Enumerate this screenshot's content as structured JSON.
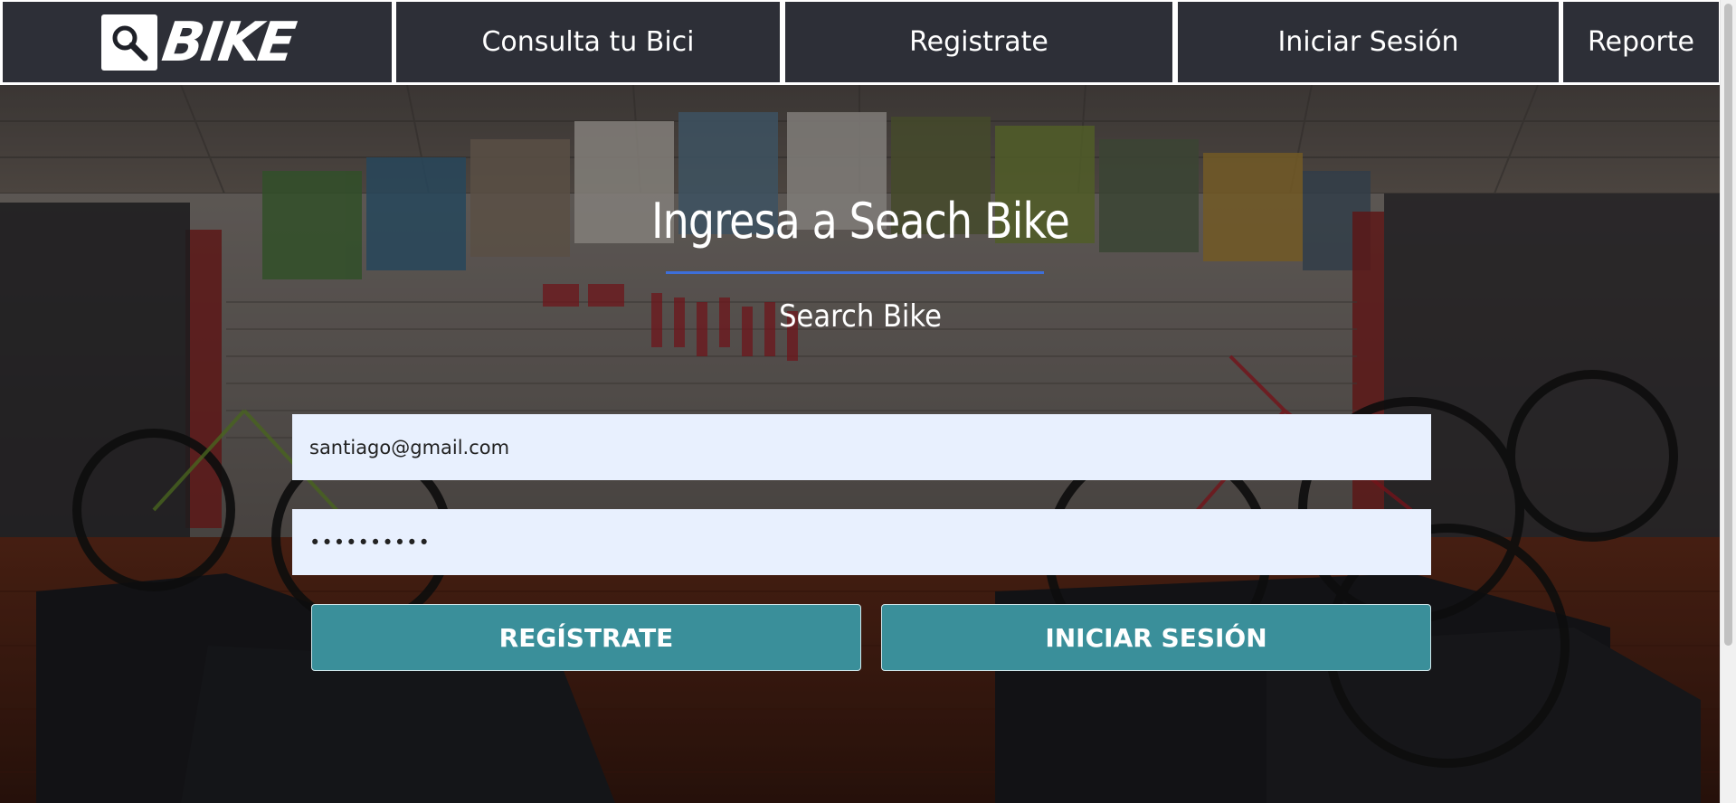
{
  "nav": {
    "logo_text": "BIKE",
    "items": [
      {
        "label": "Consulta tu Bici"
      },
      {
        "label": "Registrate"
      },
      {
        "label": "Iniciar Sesión"
      },
      {
        "label": "Reporte"
      }
    ]
  },
  "hero": {
    "title": "Ingresa a Seach Bike",
    "subtitle": "Search Bike"
  },
  "form": {
    "email_value": "santiago@gmail.com",
    "password_value": "••••••••••",
    "register_button": "REGÍSTRATE",
    "login_button": "INICIAR SESIÓN"
  },
  "colors": {
    "nav_bg": "#2d2f37",
    "field_bg": "#e8f0fe",
    "button_bg": "#3a8f9a",
    "underline": "#3d6fd9"
  }
}
